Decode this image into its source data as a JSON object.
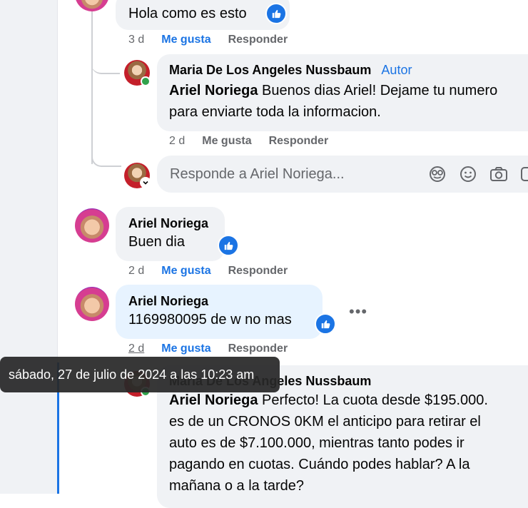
{
  "comments": [
    {
      "text": "Hola como es esto",
      "time": "3 d",
      "like_label": "Me gusta",
      "reply_label": "Responder"
    },
    {
      "author": "Maria De Los Angeles Nussbaum",
      "badge": "Autor",
      "mention": "Ariel Noriega",
      "text": "Buenos dias Ariel! Dejame tu numero",
      "text2": "para enviarte toda la informacion.",
      "time": "2 d",
      "like_label": "Me gusta",
      "reply_label": "Responder"
    },
    {
      "author": "Ariel Noriega",
      "text": "Buen dia",
      "time": "2 d",
      "like_label": "Me gusta",
      "reply_label": "Responder"
    },
    {
      "author": "Ariel Noriega",
      "text": "1169980095 de w no mas",
      "time": "2 d",
      "like_label": "Me gusta",
      "reply_label": "Responder",
      "more": "•••"
    },
    {
      "author": "Maria De Los Angeles Nussbaum",
      "mention": "Ariel Noriega",
      "line1": "Perfecto! La cuota desde $195.000.",
      "line2": "es de un CRONOS 0KM el anticipo para retirar el",
      "line3": "auto es de $7.100.000, mientras tanto podes ir",
      "line4": "pagando en cuotas. Cuándo podes hablar? A la",
      "line5": "mañana o a la tarde?"
    }
  ],
  "reply_box": {
    "placeholder": "Responde a Ariel Noriega..."
  },
  "tooltip": {
    "text": "sábado, 27 de julio de 2024 a las 10:23 am"
  },
  "colors": {
    "accent": "#1b74e4",
    "bubble": "#f0f2f5",
    "highlight": "#e7f3ff",
    "online": "#31a24c"
  }
}
